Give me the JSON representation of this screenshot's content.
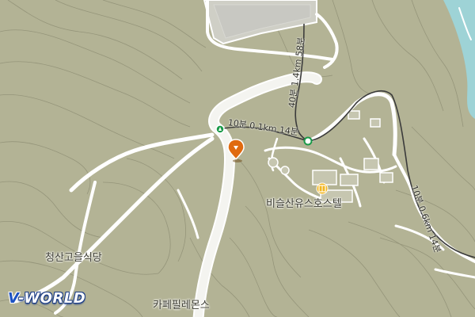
{
  "map": {
    "logo_prefix": "V",
    "logo_suffix": "-WORLD",
    "places": {
      "hotel": "비슬산유스호스텔",
      "restaurant": "청산고을식당",
      "cafe": "카페필레몬스"
    },
    "trails": {
      "upper": "40분 1.4km 58분",
      "middle": "10분 0.1km 14분",
      "right": "10분 0.6km 14분"
    },
    "icons": {
      "hotel": "hotel-icon",
      "location_pin": "location-pin-icon",
      "start_marker": "trail-start-marker-icon",
      "node_marker": "trail-node-marker-icon"
    },
    "colors": {
      "terrain": "#b3b395",
      "road": "#ffffff",
      "water": "#9ed3d6",
      "contour": "#8e8e74",
      "trail": "#3b3b3b",
      "hotel_icon": "#f2b621",
      "pin": "#e06a10",
      "green_marker": "#1a9a48",
      "logo_blue": "#1c52c2"
    }
  }
}
